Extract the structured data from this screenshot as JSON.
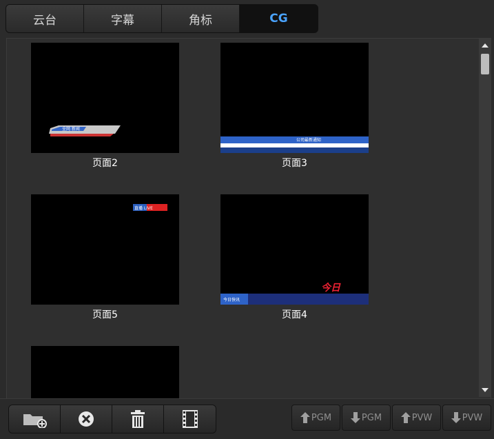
{
  "tabs": [
    "云台",
    "字幕",
    "角标",
    "CG"
  ],
  "active_tab": "CG",
  "pages": [
    {
      "label": "页面2",
      "overlay": "lower-third-small",
      "overlay_text": "全网 新闻"
    },
    {
      "label": "页面3",
      "overlay": "ticker-blue",
      "overlay_text": "公司最新通知"
    },
    {
      "label": "页面5",
      "overlay": "live-badge",
      "overlay_text": "直播 LIVE"
    },
    {
      "label": "页面4",
      "overlay": "ticker-red-title",
      "overlay_text": "今日快讯"
    },
    {
      "label": "",
      "overlay": "none",
      "overlay_text": ""
    }
  ],
  "toolbar": {
    "add_folder_icon": "folder-add-icon",
    "close_icon": "close-circle-icon",
    "delete_icon": "trash-icon",
    "film_icon": "film-icon"
  },
  "output_buttons": [
    {
      "label": "PGM",
      "dir": "up"
    },
    {
      "label": "PGM",
      "dir": "down"
    },
    {
      "label": "PVW",
      "dir": "up"
    },
    {
      "label": "PVW",
      "dir": "down"
    }
  ]
}
